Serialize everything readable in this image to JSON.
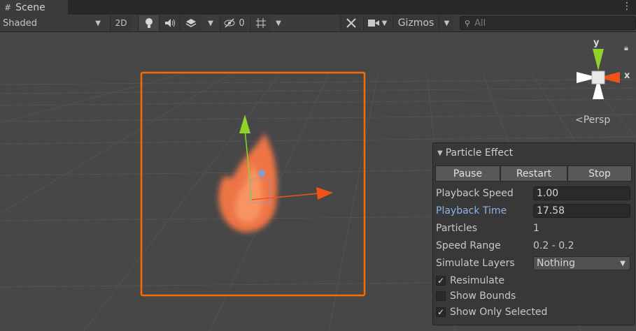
{
  "tab": {
    "title": "Scene",
    "menu": "⋮"
  },
  "toolbar": {
    "shading_mode": "Shaded",
    "mode_2d": "2D",
    "hidden_count": "0",
    "gizmos_label": "Gizmos",
    "search_placeholder": "All"
  },
  "viewport": {
    "projection_label": "Persp",
    "axis_y": "y",
    "axis_x": "x"
  },
  "particle_panel": {
    "title": "Particle Effect",
    "buttons": {
      "pause": "Pause",
      "restart": "Restart",
      "stop": "Stop"
    },
    "playback_speed_label": "Playback Speed",
    "playback_speed": "1.00",
    "playback_time_label": "Playback Time",
    "playback_time": "17.58",
    "particles_label": "Particles",
    "particles": "1",
    "speed_range_label": "Speed Range",
    "speed_range": "0.2 - 0.2",
    "simulate_layers_label": "Simulate Layers",
    "simulate_layers": "Nothing",
    "resimulate_label": "Resimulate",
    "resimulate": true,
    "show_bounds_label": "Show Bounds",
    "show_bounds": false,
    "show_only_selected_label": "Show Only Selected",
    "show_only_selected": true
  },
  "colors": {
    "selection_outline": "#ff6a00",
    "flame": "#ff7a45",
    "axis_y": "#8fd22a",
    "axis_x": "#f0521a",
    "link_label": "#8ab4e8"
  }
}
